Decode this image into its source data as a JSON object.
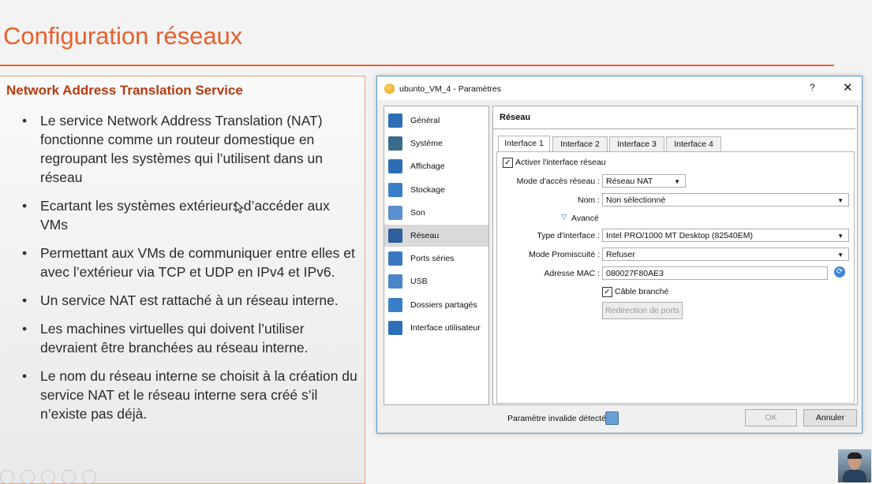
{
  "slide": {
    "title": "Configuration réseaux",
    "heading": "Network Address Translation Service",
    "bullets": [
      "Le service Network Address Translation (NAT) fonctionne comme un routeur domestique en regroupant les systèmes qui l’utilisent dans un réseau",
      "Ecartant les systèmes extérieurs d’accéder aux VMs",
      "Permettant aux VMs de communiquer entre elles et avec l’extérieur via TCP et UDP en IPv4 et IPv6.",
      "Un service NAT est rattaché à un réseau interne.",
      "Les machines virtuelles qui doivent l’utiliser devraient être branchées au réseau interne.",
      "Le nom du réseau interne se choisit à la création du service NAT et le réseau interne sera créé s’il n’existe pas déjà."
    ],
    "bullet_char": "•",
    "accent_color": "#e8602c"
  },
  "dialog": {
    "title": "ubunto_VM_4 - Paramètres",
    "help_label": "?",
    "close_label": "✕",
    "sidebar": [
      {
        "label": "Général",
        "icon": "monitor-icon",
        "color": "#2c6fb7"
      },
      {
        "label": "Système",
        "icon": "chip-icon",
        "color": "#3a6a8a"
      },
      {
        "label": "Affichage",
        "icon": "display-icon",
        "color": "#2c6fb7"
      },
      {
        "label": "Stockage",
        "icon": "disk-icon",
        "color": "#3b7ec8"
      },
      {
        "label": "Son",
        "icon": "speaker-icon",
        "color": "#5a8fd0"
      },
      {
        "label": "Réseau",
        "icon": "network-icon",
        "color": "#2e5f9e"
      },
      {
        "label": "Ports séries",
        "icon": "serial-port-icon",
        "color": "#3a78c0"
      },
      {
        "label": "USB",
        "icon": "usb-icon",
        "color": "#4a86c8"
      },
      {
        "label": "Dossiers partagés",
        "icon": "folder-icon",
        "color": "#3b7ec8"
      },
      {
        "label": "Interface utilisateur",
        "icon": "ui-window-icon",
        "color": "#2c6fb7"
      }
    ],
    "selected_index": 5,
    "section_title": "Réseau",
    "tabs": [
      "Interface 1",
      "Interface 2",
      "Interface 3",
      "Interface 4"
    ],
    "active_tab": 0,
    "enable_label": "Activer l'interface réseau",
    "enable_checked": true,
    "mode_label": "Mode d'accès réseau :",
    "mode_value": "Réseau NAT",
    "name_label": "Nom :",
    "name_value": "Non sélectionné",
    "advanced_label": "Avancé",
    "adapter_label": "Type d'interface :",
    "adapter_value": "Intel PRO/1000 MT Desktop (82540EM)",
    "promisc_label": "Mode Promiscuité :",
    "promisc_value": "Refuser",
    "mac_label": "Adresse MAC :",
    "mac_value": "080027F80AE3",
    "cable_label": "Câble branché",
    "cable_checked": true,
    "port_forward_label": "Redirection de ports",
    "invalid_label": "Paramètre invalide détecté",
    "ok_label": "OK",
    "cancel_label": "Annuler"
  }
}
